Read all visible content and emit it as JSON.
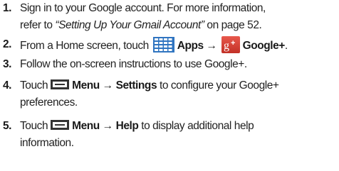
{
  "steps": [
    {
      "number": "1.",
      "line1": "Sign in to your Google account. For more information,",
      "line2_pre": "refer to ",
      "line2_italic": "“Setting Up Your Gmail Account”",
      "line2_post": " on page 52."
    },
    {
      "number": "2.",
      "pre": "From a Home screen, touch",
      "apps_label": "Apps",
      "arrow": "→",
      "gplus_label": "Google+",
      "end": "."
    },
    {
      "number": "3.",
      "text": "Follow the on-screen instructions to use Google+."
    },
    {
      "number": "4.",
      "pre": "Touch",
      "menu_label": "Menu",
      "arrow": "→",
      "target_label": "Settings",
      "post": " to configure your Google+",
      "line2": "preferences."
    },
    {
      "number": "5.",
      "pre": "Touch",
      "menu_label": "Menu",
      "arrow": "→",
      "target_label": "Help",
      "post": " to display additional help",
      "line2": "information."
    }
  ],
  "icons": {
    "apps": "apps-grid-icon",
    "gplus": "google-plus-icon",
    "menu": "menu-icon"
  },
  "colors": {
    "apps_icon": "#2f74c0",
    "gplus_icon": "#d73d32",
    "menu_icon": "#333333",
    "text": "#222222"
  }
}
